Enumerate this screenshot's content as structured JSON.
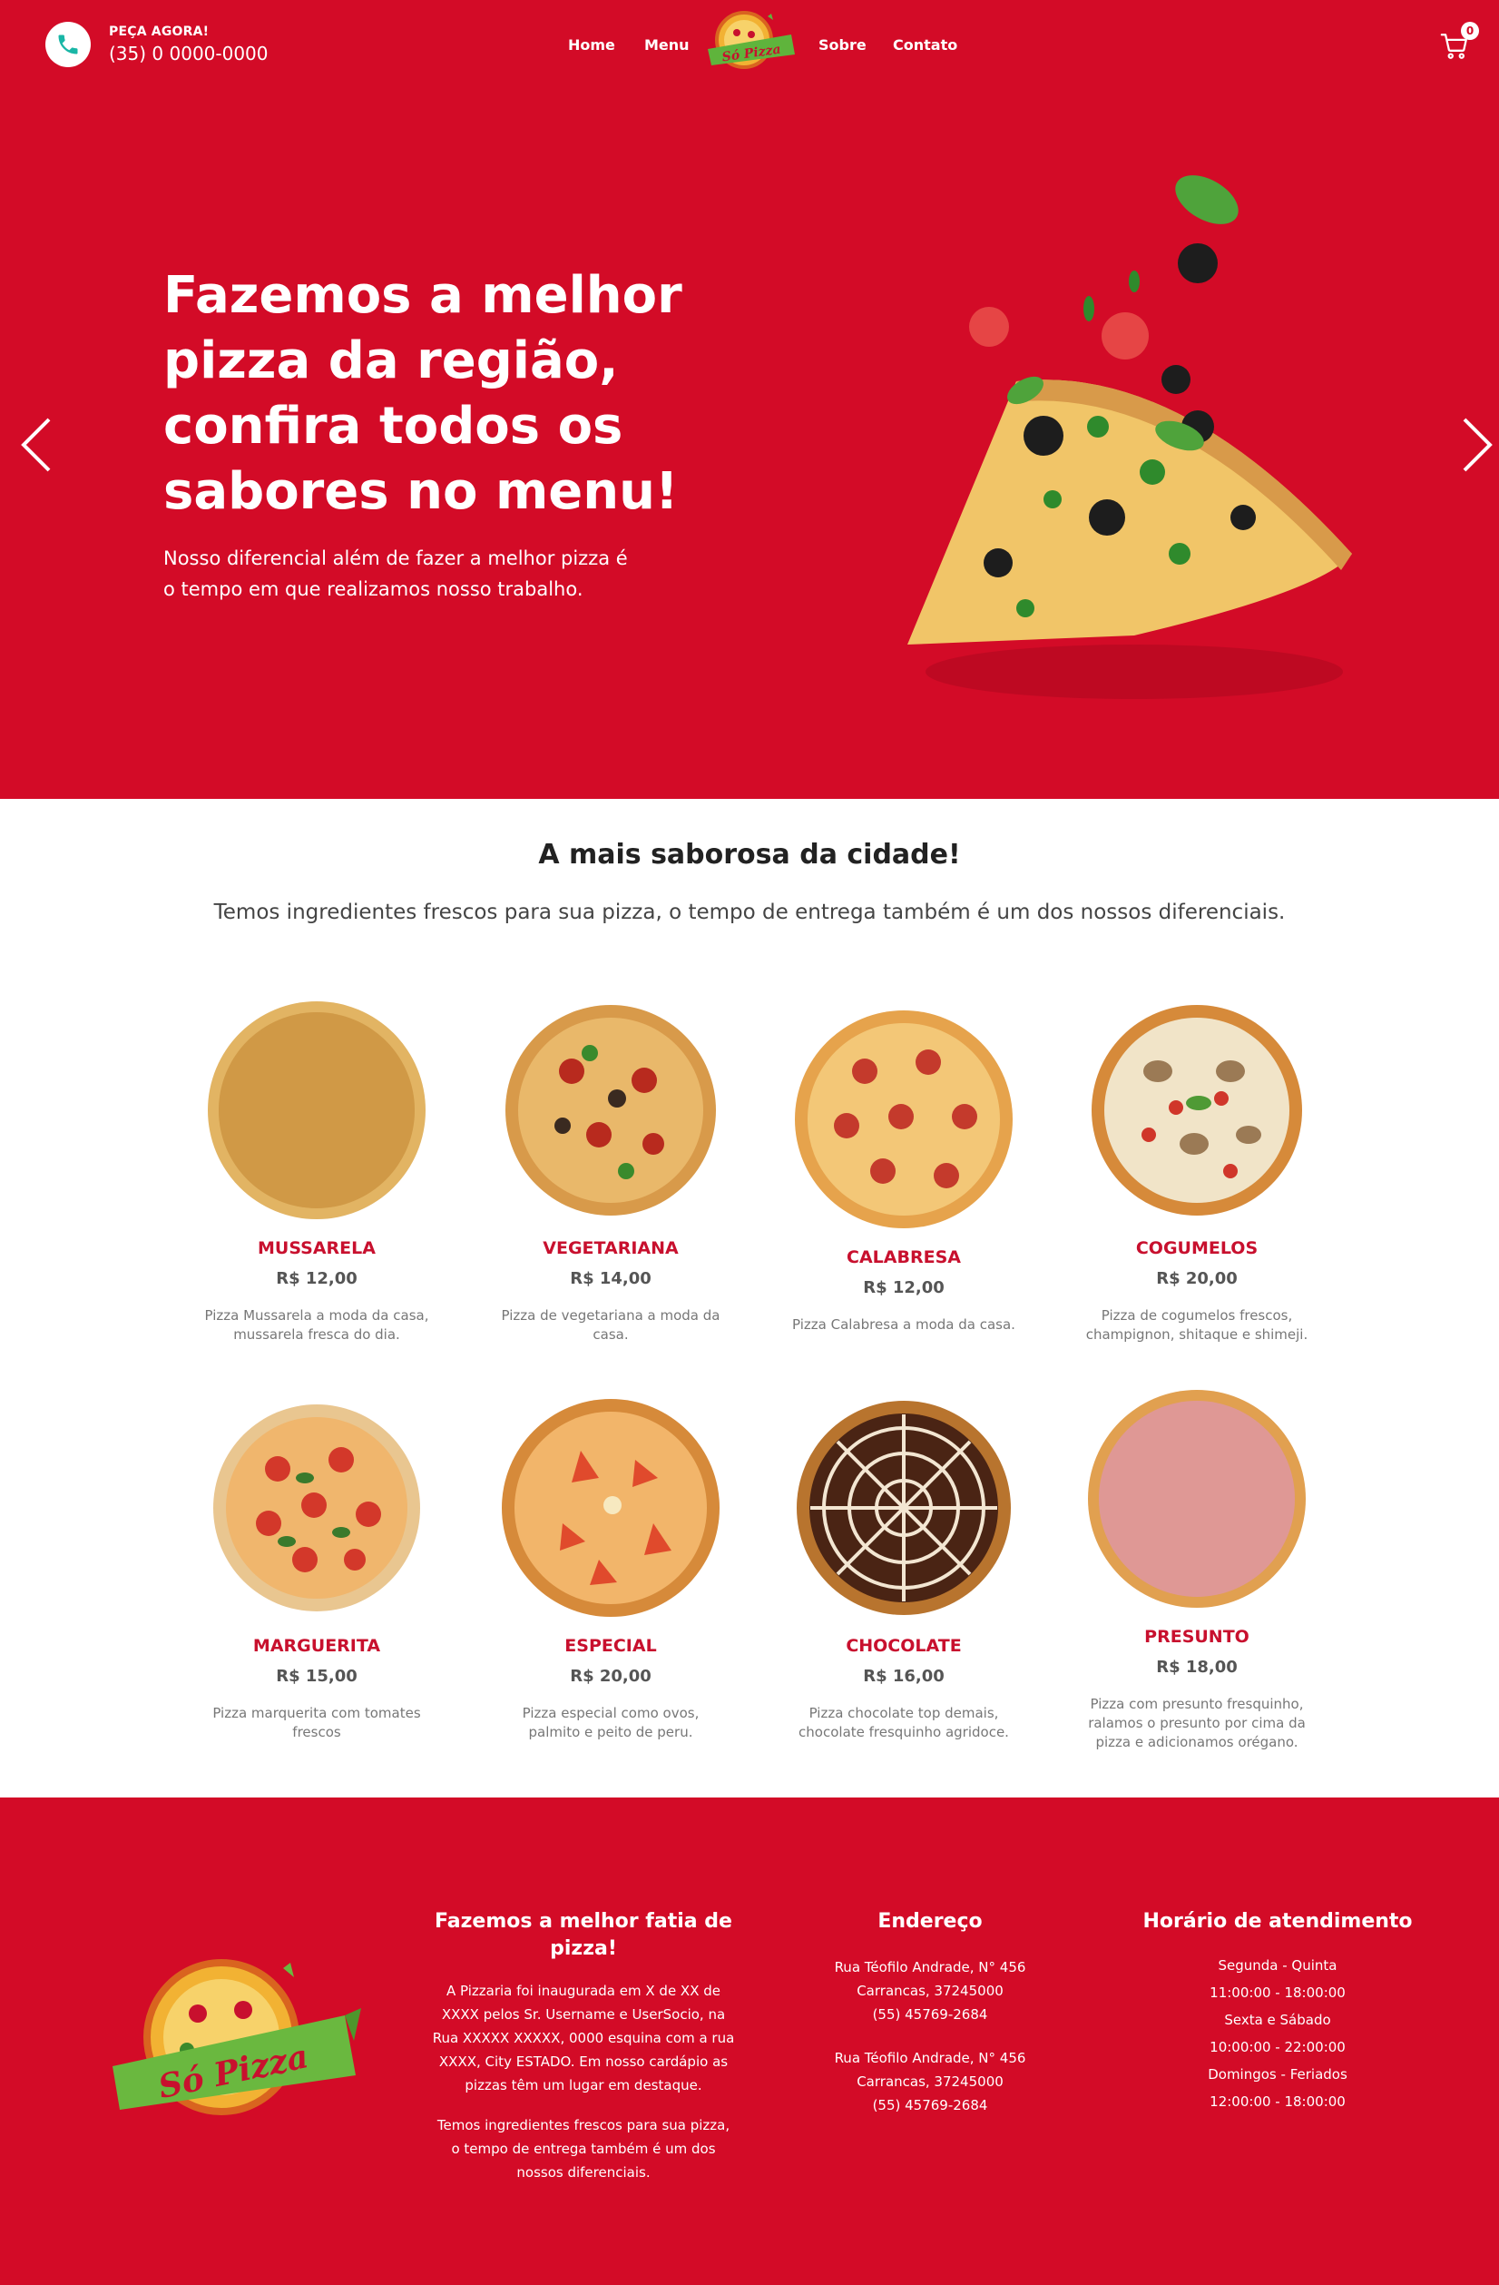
{
  "header": {
    "order_label": "PEÇA AGORA!",
    "phone": "(35) 0 0000-0000",
    "nav": [
      "Home",
      "Menu",
      "Sobre",
      "Contato"
    ],
    "logo_text": "Só Pizza",
    "cart_count": "0"
  },
  "hero": {
    "title": "Fazemos a melhor pizza da região, confira todos os sabores no menu!",
    "subtitle": "Nosso diferencial além de fazer a melhor pizza é o tempo em que realizamos nosso trabalho."
  },
  "menu": {
    "title": "A mais saborosa da cidade!",
    "subtitle": "Temos ingredientes frescos para sua pizza, o tempo de entrega também é um dos nossos diferenciais.",
    "items": [
      {
        "name": "MUSSARELA",
        "price": "R$ 12,00",
        "desc": "Pizza Mussarela a moda da casa, mussarela fresca do dia."
      },
      {
        "name": "VEGETARIANA",
        "price": "R$ 14,00",
        "desc": "Pizza de vegetariana a moda da casa."
      },
      {
        "name": "CALABRESA",
        "price": "R$ 12,00",
        "desc": "Pizza Calabresa a moda da casa."
      },
      {
        "name": "COGUMELOS",
        "price": "R$ 20,00",
        "desc": "Pizza de cogumelos frescos, champignon, shitaque e shimeji."
      },
      {
        "name": "MARGUERITA",
        "price": "R$ 15,00",
        "desc": "Pizza marquerita com tomates frescos"
      },
      {
        "name": "ESPECIAL",
        "price": "R$ 20,00",
        "desc": "Pizza especial como ovos, palmito e peito de peru."
      },
      {
        "name": "CHOCOLATE",
        "price": "R$ 16,00",
        "desc": "Pizza chocolate top demais, chocolate fresquinho agridoce."
      },
      {
        "name": "PRESUNTO",
        "price": "R$ 18,00",
        "desc": "Pizza com presunto fresquinho, ralamos o presunto por cima da pizza e adicionamos orégano."
      }
    ]
  },
  "footer": {
    "about_title": "Fazemos a melhor fatia de pizza!",
    "about_p1": "A Pizzaria foi inaugurada em X de XX de XXXX pelos Sr. Username e UserSocio, na Rua XXXXX XXXXX, 0000 esquina com a rua XXXX, City ESTADO. Em nosso cardápio as pizzas têm um lugar em destaque.",
    "about_p2": "Temos ingredientes frescos para sua pizza, o tempo de entrega também é um dos nossos diferenciais.",
    "address_title": "Endereço",
    "addresses": [
      {
        "street": "Rua Téofilo Andrade, N° 456",
        "city": "Carrancas, 37245000",
        "phone": "(55) 45769-2684"
      },
      {
        "street": "Rua Téofilo Andrade, N° 456",
        "city": "Carrancas, 37245000",
        "phone": "(55) 45769-2684"
      }
    ],
    "hours_title": "Horário de atendimento",
    "hours": [
      "Segunda - Quinta",
      "11:00:00 - 18:00:00",
      "Sexta e Sábado",
      "10:00:00 - 22:00:00",
      "Domingos - Feriados",
      "12:00:00 - 18:00:00"
    ]
  },
  "colors": {
    "brand_red": "#d30b27",
    "item_title_red": "#c8102e",
    "phone_teal": "#19b6a6"
  }
}
